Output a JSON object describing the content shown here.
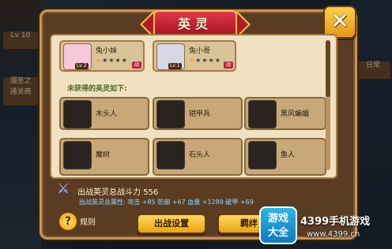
{
  "background": {
    "left_badges": [
      "Lv 10",
      "溺圣之",
      "通关商"
    ],
    "right_badge": "日常"
  },
  "dialog": {
    "title": "英灵",
    "close_glyph": "✕"
  },
  "owned_heroes": [
    {
      "name": "兔小妹",
      "level": "Lv 2",
      "stars_filled": 1,
      "stars_total": 5,
      "tag": "战",
      "portrait_color": "#f7c8d8"
    },
    {
      "name": "兔小哥",
      "level": "Lv 1",
      "stars_filled": 1,
      "stars_total": 5,
      "tag": "战",
      "portrait_color": "#d7d7e6"
    }
  ],
  "unowned_heading": "未获得的英灵如下:",
  "locked_heroes": [
    {
      "name": "木头人"
    },
    {
      "name": "铠甲兵"
    },
    {
      "name": "黑风蝙蝠"
    },
    {
      "name": "魔树"
    },
    {
      "name": "石头人"
    },
    {
      "name": "鱼人"
    }
  ],
  "summary": {
    "power_label": "出战英灵总战斗力",
    "power_value": "556",
    "attr_prefix": "出战英灵总属性:",
    "attack": "攻击 +85",
    "defense": "防御 +67",
    "hp": "血量 +1289",
    "crit": "破甲 +69"
  },
  "buttons": {
    "help_glyph": "?",
    "rules_label": "规则",
    "battle_setup": "出战设置",
    "bond": "羁绊"
  },
  "watermark": {
    "badge_line1": "游戏",
    "badge_line2": "大全",
    "brand": "4399手机游戏",
    "url": "www.4399.cn"
  },
  "colors": {
    "panel_brown": "#5a3c22",
    "panel_gold": "#c89654",
    "title_red": "#b4192a",
    "button_gold": "#ffd95a",
    "attr_green": "#6cff4a"
  }
}
